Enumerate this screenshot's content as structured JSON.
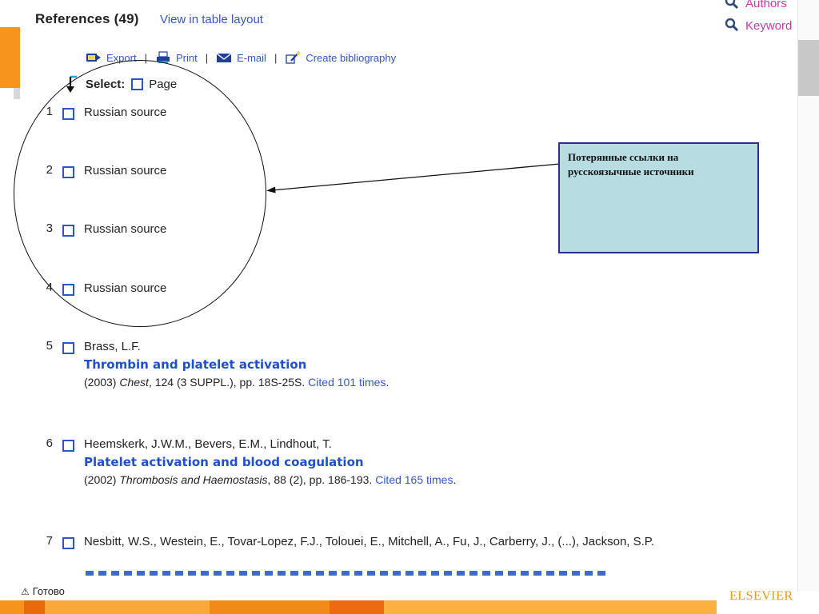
{
  "header": {
    "title": "References (49)",
    "table_layout_link": "View in table layout",
    "authors_link": "Authors",
    "keyword_link": "Keyword"
  },
  "toolbar": {
    "export": "Export",
    "print": "Print",
    "email": "E-mail",
    "bibliography": "Create bibliography",
    "separator": "|"
  },
  "select": {
    "label": "Select:",
    "page": "Page"
  },
  "references": [
    {
      "num": "1",
      "authors": "Russian source"
    },
    {
      "num": "2",
      "authors": "Russian source"
    },
    {
      "num": "3",
      "authors": "Russian source"
    },
    {
      "num": "4",
      "authors": "Russian source"
    },
    {
      "num": "5",
      "authors": "Brass, L.F.",
      "title": "Thrombin and platelet activation",
      "year": "(2003)",
      "journal": "Chest",
      "details": ", 124 (3 SUPPL.), pp. 18S-25S.",
      "cited": "Cited 101 times",
      "end": "."
    },
    {
      "num": "6",
      "authors": "Heemskerk, J.W.M., Bevers, E.M., Lindhout, T.",
      "title": "Platelet activation and blood coagulation",
      "year": "(2002)",
      "journal": "Thrombosis and Haemostasis",
      "details": ", 88 (2), pp. 186-193.",
      "cited": "Cited 165 times",
      "end": "."
    },
    {
      "num": "7",
      "authors": "Nesbitt, W.S., Westein, E., Tovar-Lopez, F.J., Tolouei, E., Mitchell, A., Fu, J., Carberry, J., (...), Jackson, S.P."
    }
  ],
  "annotation": {
    "text": "Потерянные ссылки на русскоязычные источники"
  },
  "status": {
    "text": "Готово"
  },
  "brand": {
    "name": "ELSEVIER"
  },
  "colors": {
    "accent_orange": "#f7941d",
    "link_blue": "#3355cc",
    "title_blue": "#1d4fd0",
    "side_link_pink": "#d236a8",
    "note_bg": "#b7dde3",
    "note_border": "#2c2f8a"
  }
}
